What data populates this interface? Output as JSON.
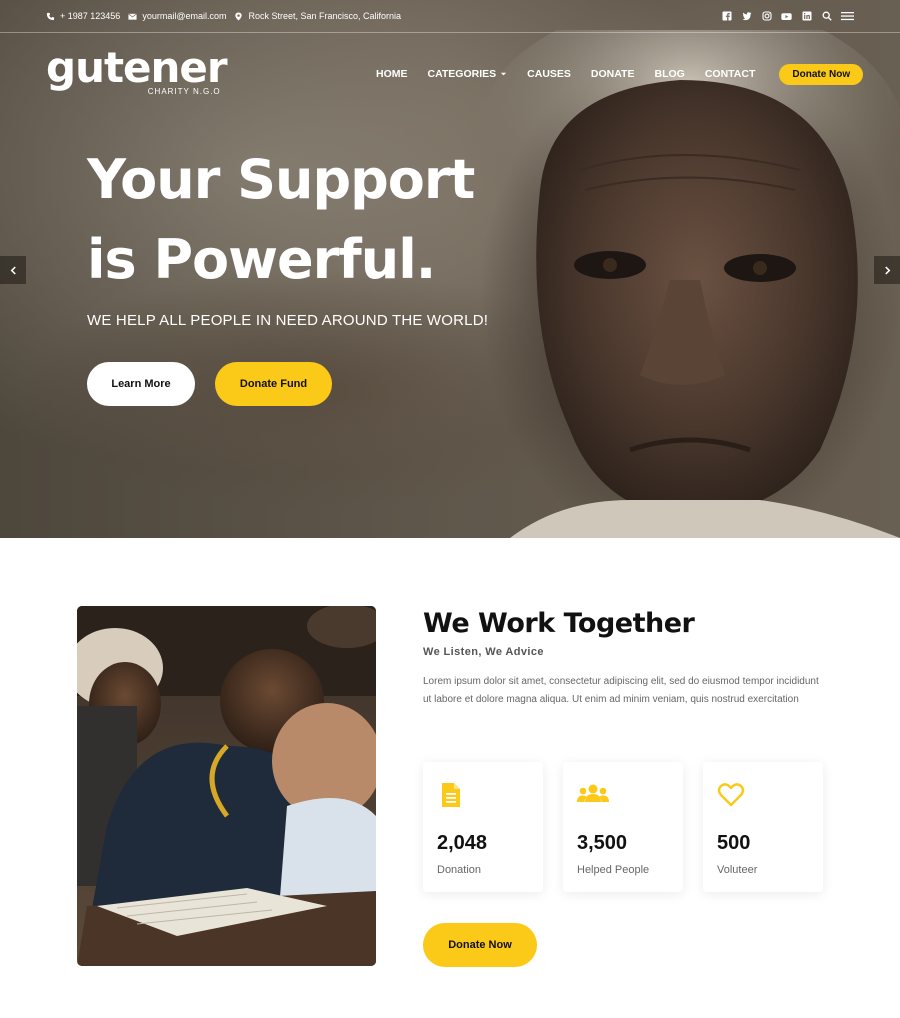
{
  "topbar": {
    "phone": "+ 1987 123456",
    "email": "yourmail@email.com",
    "address": "Rock Street, San Francisco, California",
    "social_icons": [
      "facebook-icon",
      "twitter-icon",
      "instagram-icon",
      "youtube-icon",
      "linkedin-icon",
      "search-icon",
      "menu-icon"
    ]
  },
  "logo": {
    "name": "gutener",
    "tagline": "CHARITY N.G.O"
  },
  "nav": {
    "items": [
      "HOME",
      "CATEGORIES",
      "CAUSES",
      "DONATE",
      "BLOG",
      "CONTACT"
    ],
    "cta": "Donate Now"
  },
  "hero": {
    "title_line1": "Your Support",
    "title_line2": "is Powerful.",
    "subtitle": "WE HELP ALL PEOPLE IN NEED AROUND THE WORLD!",
    "learn_more": "Learn More",
    "donate_fund": "Donate Fund"
  },
  "about": {
    "title": "We Work Together",
    "tagline": "We Listen, We Advice",
    "text": "Lorem ipsum dolor sit amet, consectetur adipiscing elit, sed do eiusmod tempor incididunt ut labore et dolore magna aliqua. Ut enim ad minim veniam, quis nostrud exercitation",
    "stats": [
      {
        "icon": "document-icon",
        "value": "2,048",
        "label": "Donation"
      },
      {
        "icon": "people-icon",
        "value": "3,500",
        "label": "Helped People"
      },
      {
        "icon": "heart-icon",
        "value": "500",
        "label": "Voluteer"
      }
    ],
    "cta": "Donate Now"
  },
  "colors": {
    "accent": "#fbc918",
    "text_dark": "#111111",
    "text_muted": "#666666"
  }
}
